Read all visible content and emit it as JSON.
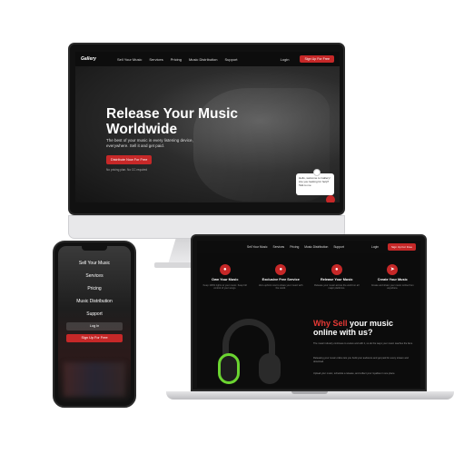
{
  "desktop": {
    "logo": "Gallery",
    "nav_links": [
      "Sell Your Music",
      "Services",
      "Pricing",
      "Music Distribution",
      "Support"
    ],
    "login": "Login",
    "signup": "Sign Up For Free",
    "hero_title": "Release Your Music Worldwide",
    "hero_subtitle": "The best of your music in every listening device, everywhere. Sell it and get paid.",
    "cta": "Distribute Now For Free",
    "note": "No pricing plan. No CC required",
    "chat_text": "Hello, welcome to Gallery! Are you looking for help? Talk to me"
  },
  "laptop": {
    "nav_links": [
      "Sell Your Music",
      "Services",
      "Pricing",
      "Music Distribution",
      "Support"
    ],
    "login": "Login",
    "signup": "Sign Up For Free",
    "features": [
      {
        "title": "Own Your Music",
        "text": "Keep 100% rights to your music. Keep full control of your songs."
      },
      {
        "title": "Exclusive Free Service",
        "text": "Zero upfront cost to share your music with the world."
      },
      {
        "title": "Release Your Music",
        "text": "Release your music across the world on all major platforms."
      },
      {
        "title": "Create Your Music",
        "text": "Create and share your music online from anywhere."
      }
    ],
    "why_prefix": "Why Sell",
    "why_suffix": "your music online with us?",
    "body_1": "The music industry continues to evolve and with it, so do the ways your music reaches the fans.",
    "body_2": "Releasing your music online lets you build your audience and get paid for every stream and download.",
    "body_3": "Upload your music, schedule a release, and collect your royalties in one place."
  },
  "phone": {
    "menu": [
      "Sell Your Music",
      "Services",
      "Pricing",
      "Music Distribution",
      "Support"
    ],
    "login": "Log In",
    "signup": "Sign Up For Free"
  }
}
